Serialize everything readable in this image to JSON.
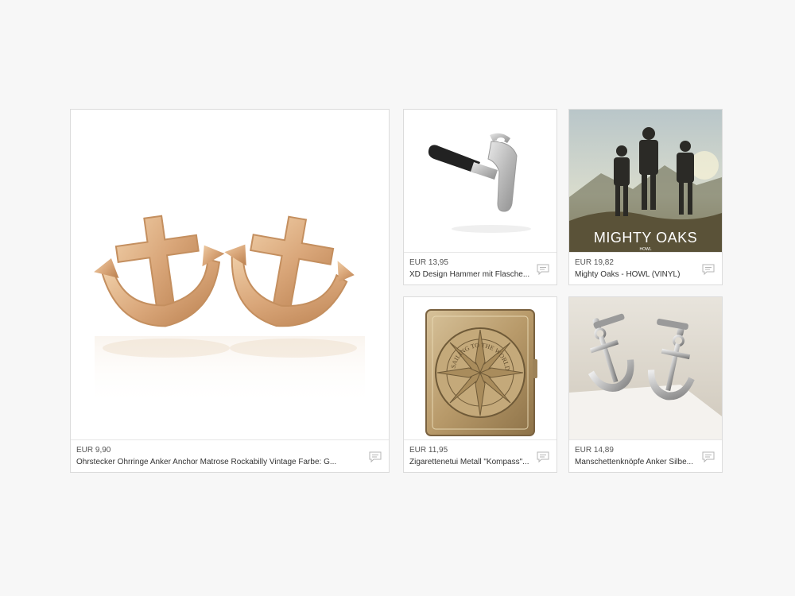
{
  "products": [
    {
      "price": "EUR 9,90",
      "title": "Ohrstecker Ohrringe Anker Anchor Matrose Rockabilly Vintage Farbe: G...",
      "icon": "comment-icon"
    },
    {
      "price": "EUR 13,95",
      "title": "XD Design Hammer mit Flasche...",
      "icon": "comment-icon"
    },
    {
      "price": "EUR 19,82",
      "title": "Mighty Oaks - HOWL (VINYL)",
      "icon": "comment-icon",
      "cover_title": "MIGHTY OAKS",
      "cover_subtitle": "HOWL"
    },
    {
      "price": "EUR 11,95",
      "title": "Zigarettenetui Metall \"Kompass\"...",
      "icon": "comment-icon",
      "engraving": "SAILING TO THE WORLD"
    },
    {
      "price": "EUR 14,89",
      "title": "Manschettenknöpfe Anker Silbe...",
      "icon": "comment-icon"
    }
  ],
  "colors": {
    "page_bg": "#f7f7f7",
    "card_border": "#dcdcdc",
    "gold": "#d9a77a",
    "brass": "#b89a6a"
  }
}
